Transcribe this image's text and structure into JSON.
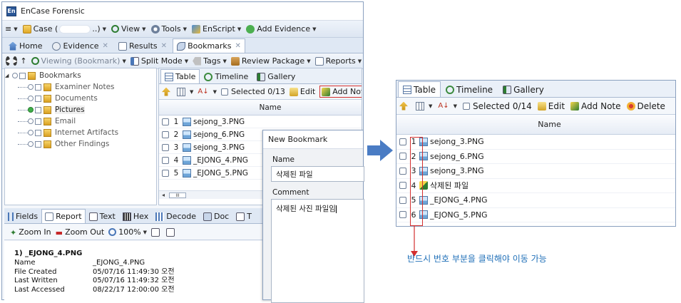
{
  "window": {
    "title": "EnCase Forensic",
    "app_icon_text": "En"
  },
  "menubar": {
    "items": [
      {
        "label": "Case (",
        "suffix": "..)",
        "icon": "case-folder-icon"
      },
      {
        "label": "View",
        "icon": "view-icon"
      },
      {
        "label": "Tools",
        "icon": "gear-icon"
      },
      {
        "label": "EnScript",
        "icon": "enscript-icon"
      },
      {
        "label": "Add Evidence",
        "icon": "add-evidence-icon"
      }
    ]
  },
  "tabs": [
    {
      "label": "Home",
      "closable": false
    },
    {
      "label": "Evidence",
      "closable": true
    },
    {
      "label": "Results",
      "closable": true
    },
    {
      "label": "Bookmarks",
      "closable": true,
      "active": true
    }
  ],
  "toolbar": {
    "viewing": "Viewing (Bookmark)",
    "split_mode": "Split Mode",
    "tags": "Tags",
    "review_package": "Review Package",
    "reports": "Reports"
  },
  "tree": {
    "root": "Bookmarks",
    "items": [
      "Examiner Notes",
      "Documents",
      "Pictures",
      "Email",
      "Internet Artifacts",
      "Other Findings"
    ],
    "selected": "Pictures"
  },
  "left_table": {
    "tabs": [
      "Table",
      "Timeline",
      "Gallery"
    ],
    "selected_count": "Selected 0/13",
    "edit": "Edit",
    "add_note": "Add Note",
    "column": "Name",
    "rows": [
      {
        "num": "1",
        "name": "sejong_3.PNG"
      },
      {
        "num": "2",
        "name": "sejong_6.PNG"
      },
      {
        "num": "3",
        "name": "sejong_3.PNG"
      },
      {
        "num": "4",
        "name": "_EJONG_4.PNG"
      },
      {
        "num": "5",
        "name": "_EJONG_5.PNG"
      }
    ],
    "scroll_left": "◂",
    "scroll_thumb": "III"
  },
  "bottom_tabs": [
    "Fields",
    "Report",
    "Text",
    "Hex",
    "Decode",
    "Doc",
    "T"
  ],
  "zoom": {
    "zoom_in": "Zoom In",
    "zoom_out": "Zoom Out",
    "level": "100%"
  },
  "report": {
    "title": "1) _EJONG_4.PNG",
    "lines": [
      {
        "k": "Name",
        "v": "_EJONG_4.PNG"
      },
      {
        "k": "File Created",
        "v": "05/07/16 11:49:30 오전"
      },
      {
        "k": "Last Written",
        "v": "05/07/16 11:49:32 오전"
      },
      {
        "k": "Last Accessed",
        "v": "08/22/17 12:00:00 오전"
      }
    ]
  },
  "dialog": {
    "title": "New Bookmark",
    "name_label": "Name",
    "name_value": "삭제된 파일",
    "comment_label": "Comment",
    "comment_value": "삭제된 사진 파일임"
  },
  "right_panel": {
    "tabs": [
      "Table",
      "Timeline",
      "Gallery"
    ],
    "selected_count": "Selected 0/14",
    "edit": "Edit",
    "add_note": "Add Note",
    "delete": "Delete",
    "column": "Name",
    "rows": [
      {
        "num": "1",
        "name": "sejong_3.PNG",
        "icon": "png-icon"
      },
      {
        "num": "2",
        "name": "sejong_6.PNG",
        "icon": "png-icon"
      },
      {
        "num": "3",
        "name": "sejong_3.PNG",
        "icon": "png-icon"
      },
      {
        "num": "4",
        "name": "삭제된 파일",
        "icon": "note-icon"
      },
      {
        "num": "5",
        "name": "_EJONG_4.PNG",
        "icon": "png-icon"
      },
      {
        "num": "6",
        "name": "_EJONG_5.PNG",
        "icon": "png-icon"
      }
    ]
  },
  "callout": "반드시 번호 부분을 클릭해야 이동 가능",
  "colors": {
    "highlight": "#d32f2f",
    "callout": "#1f6fb8",
    "arrow": "#4a7cc4"
  }
}
